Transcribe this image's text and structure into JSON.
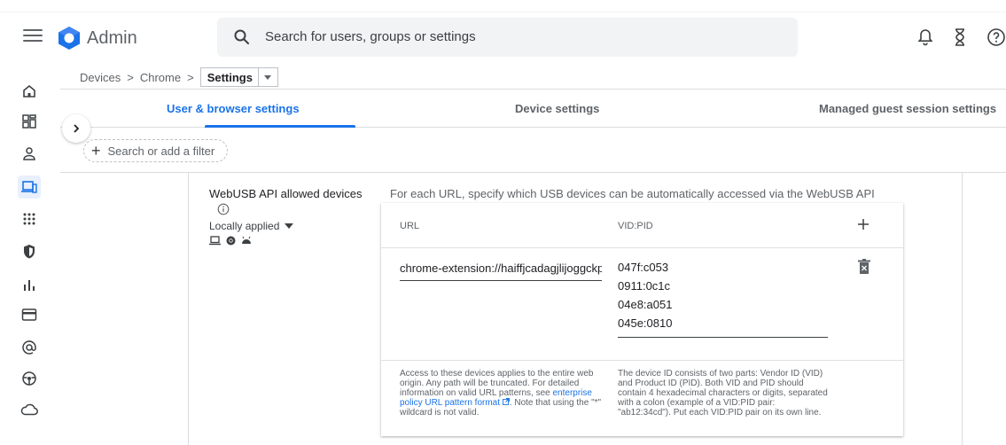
{
  "header": {
    "app_name": "Admin",
    "search_placeholder": "Search for users, groups or settings"
  },
  "breadcrumb": {
    "items": [
      "Devices",
      "Chrome"
    ],
    "separator": ">",
    "current": "Settings"
  },
  "tabs": [
    {
      "label": "User & browser settings",
      "active": true
    },
    {
      "label": "Device settings",
      "active": false
    },
    {
      "label": "Managed guest session settings",
      "active": false
    }
  ],
  "filter": {
    "label": "Search or add a filter"
  },
  "setting": {
    "name": "WebUSB API allowed devices",
    "applied": "Locally applied",
    "description": "For each URL, specify which USB devices can be automatically accessed via the WebUSB API"
  },
  "table": {
    "col_url": "URL",
    "col_vidpid": "VID:PID",
    "url_value": "chrome-extension://haiffjcadagjlijoggckpgfnoeiflnem",
    "vidpids": [
      "047f:c053",
      "0911:0c1c",
      "04e8:a051",
      "045e:0810"
    ],
    "help_url_1": "Access to these devices applies to the entire web origin. Any path will be truncated. For detailed information on valid URL patterns, see",
    "help_url_link": "enterprise policy URL pattern format",
    "help_url_2": ". Note that using the \"*\" wildcard is not valid.",
    "help_vid": "The device ID consists of two parts: Vendor ID (VID) and Product ID (PID). Both VID and PID should contain 4 hexadecimal characters or digits, separated with a colon (example of a VID:PID pair: \"ab12:34cd\"). Put each VID:PID pair on its own line."
  },
  "colors": {
    "accent": "#1a73e8",
    "active_rail_bg": "#e8f0fe",
    "text": "#202124",
    "muted": "#5f6368",
    "border": "#dadce0"
  },
  "icons": {
    "header": [
      "menu-icon",
      "admin-logo-icon",
      "search-icon",
      "bell-icon",
      "hourglass-icon",
      "help-icon"
    ],
    "rail": [
      "home-icon",
      "dashboard-icon",
      "user-icon",
      "devices-icon",
      "apps-icon",
      "security-icon",
      "reporting-icon",
      "billing-icon",
      "account-icon",
      "rules-icon",
      "storage-icon"
    ]
  }
}
